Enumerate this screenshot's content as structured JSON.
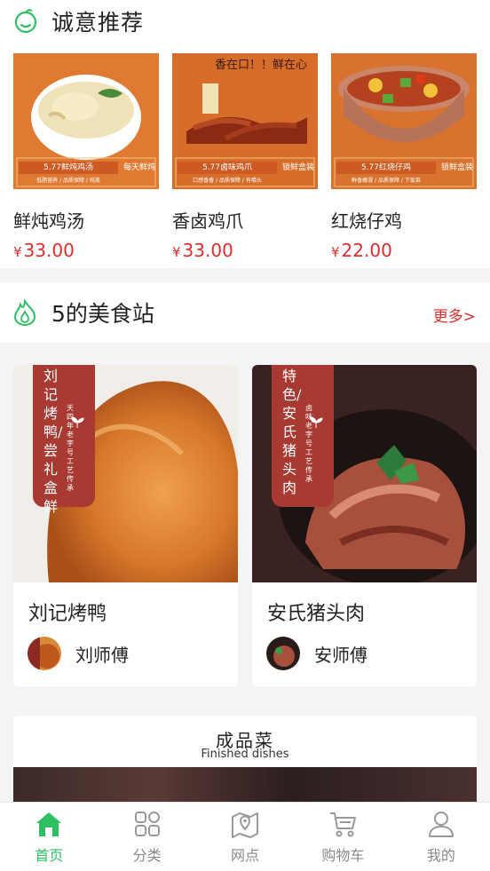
{
  "recommend": {
    "title": "诚意推荐",
    "items": [
      {
        "name": "鲜炖鸡汤",
        "currency": "¥",
        "price": "33.00",
        "banner_text": "5.77鲜炖鸡汤",
        "banner_sub": "低脂营养 / 品质保障 / 纯美",
        "side_text": "每天鲜炖"
      },
      {
        "name": "香卤鸡爪",
        "currency": "¥",
        "price": "33.00",
        "banner_text": "5.77卤味鸡爪",
        "banner_sub": "口感香香 / 品质保障 / 有嚼头",
        "side_text": "锁鲜盒装",
        "slogan": "香在口！！鲜在心"
      },
      {
        "name": "红烧仔鸡",
        "currency": "¥",
        "price": "22.00",
        "banner_text": "5.77红烧仔鸡",
        "banner_sub": "鲜香嫩滑 / 品质保障 / 下饭菜",
        "side_text": "锁鲜盒装"
      }
    ]
  },
  "station": {
    "title": "5的美食站",
    "more": "更多>"
  },
  "chefs": [
    {
      "dish": "刘记烤鸭",
      "master": "刘师傅",
      "tag_big": "刘记烤鸭/尝礼盒鲜",
      "tag_small": "天四年老字号工艺传承"
    },
    {
      "dish": "安氏猪头肉",
      "master": "安师傅",
      "tag_big": "特色/安氏猪头肉",
      "tag_small": "卤味老字号工艺传承"
    }
  ],
  "finished": {
    "title": "成品菜",
    "subtitle": "Finished dishes"
  },
  "tabbar": [
    {
      "label": "首页",
      "icon": "home-icon",
      "active": true
    },
    {
      "label": "分类",
      "icon": "category-icon",
      "active": false
    },
    {
      "label": "网点",
      "icon": "location-icon",
      "active": false
    },
    {
      "label": "购物车",
      "icon": "cart-icon",
      "active": false
    },
    {
      "label": "我的",
      "icon": "user-icon",
      "active": false
    }
  ],
  "colors": {
    "accent_green": "#2fbf63",
    "price_red": "#e02c2c",
    "tag_red": "#a83a32",
    "card_orange": "#d9742f"
  }
}
